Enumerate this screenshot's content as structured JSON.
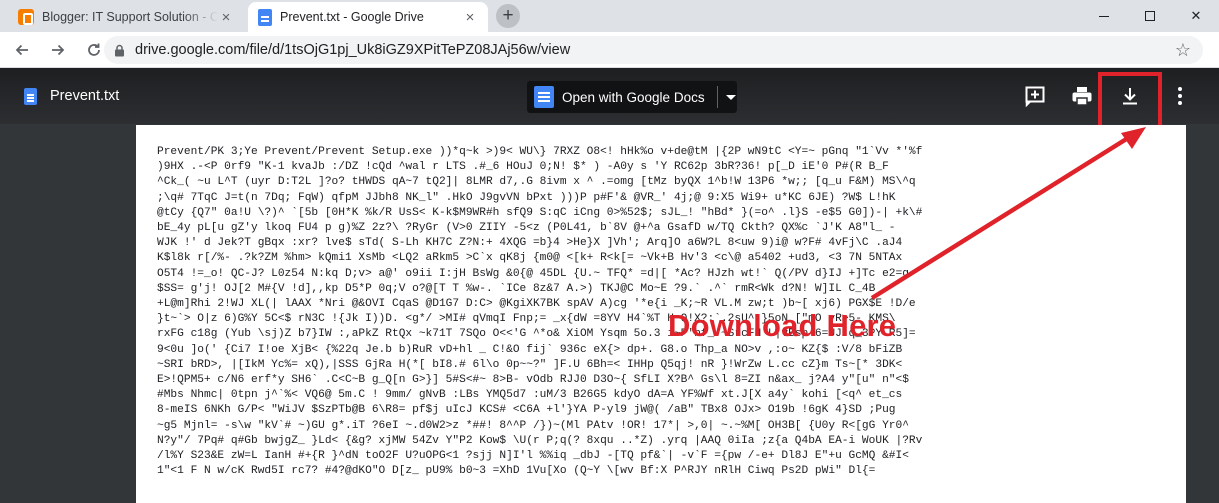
{
  "browser": {
    "tabs": [
      {
        "title": "Blogger: IT Support Solution - Cre",
        "active": false
      },
      {
        "title": "Prevent.txt - Google Drive",
        "active": true
      }
    ],
    "new_tab_label": "+",
    "close_glyph": "×",
    "window_close_glyph": "✕",
    "url": "drive.google.com/file/d/1tsOjG1pj_Uk8iGZ9XPitTePZ08JAj56w/view",
    "star_glyph": "☆"
  },
  "viewer": {
    "file_name": "Prevent.txt",
    "open_with_label": "Open with Google Docs",
    "icons": [
      "add-comment-icon",
      "print-icon",
      "download-icon",
      "more-vert-icon"
    ],
    "accent": "#e0232b"
  },
  "annotation": {
    "text": "Download Here"
  },
  "document": {
    "lines": [
      "Prevent/PK 3;Ye Prevent/Prevent Setup.exe ))*q~k >)9< WU\\} 7RXZ O8<! hHk%o v+de@tM |{2P wN9tC <Y=~ pGnq \"1`Vv *'%f",
      ")9HX .-<P 0rf9 \"K-1 kvaJb :/DZ !cQd ^wal r LTS .#_6 HOuJ 0;N! $* ) -A0y s 'Y RC62p 3bR?36! p[_D iE'0 P#(R B_F",
      "^Ck_( ~u L^T (uyr D:T2L ]?o? tHWDS qA~7 tQ2]| 8LMR d7,.G 8ivm x ^ .=omg [tMz byQX 1^b!W 13P6 *w;; [q_u F&M) MS\\^q",
      ";\\q# 7TqC J=t(n 7Dq; FqW) qfpM JJbh8 NK_l\" .HkO J9gvVN bPxt )))P p#F'& @VR_' 4j;@ 9:X5 Wi9+ u*KC 6JE) ?W$ L!hK",
      "@tCy {Q7\" 0a!U \\?)^ `[5b [0H*K %k/R UsS< K-k$M9WR#h sfQ9 S:qC iCng 0>%52$; sJL_! \"hBd* }(=o^ .l}S -e$5 G0])-| +k\\#",
      "bE_4y pL[u gZ'y lkoq FU4 p g)%Z 2z?\\ ?RyGr (V>0 ZIIY -5<z (P0L41, b`8V @+^a GsafD w/TQ Ckth? QX%c `J'K A8\"l_ -",
      "WJK !' d Jek?T gBqx :xr? lve$ sTd( S-Lh KH7C Z?N:+ 4XQG =b}4 >He}X ]Vh'; Arq]O a6W?L 8<uw 9)i@ w?F# 4vFj\\C .aJ4",
      "K$l8k r[/%- .?k?ZM %hm> kQmi1 XsMb <LQ2 aRkm5 >C`x qK8j {m0@ <[k+ R<k[= ~Vk+B Hv'3 <c\\@ a5402 +ud3, <3 7N 5NTAx",
      "O5T4 !=_o! QC-J? L0z54 N:kq D;v> a@' o9ii I:jH BsWg &0{@ 45DL {U.~ TFQ* =d|[ *Ac? HJzh wt!` Q(/PV d}IJ +]Tc e2=g",
      "$SS= g'j! OJ[2 M#{V !d],,kp D5*P 0q;V o?@[T T %w-. `ICe 8z&7 A.>) TKJ@C Mo~E ?9.` .^` rmR<Wk d?N! W]IL C_4B",
      "+L@m]Rhi 2!WJ XL(| lAAX *Nri @&OVI CqaS @D1G7 D:C> @KgiXK7BK spAV A)cg '*e{i _K;~R VL.M zw;t )b~[ xj6) PGX$E !D/e",
      "}t~`> O|z 6)G%Y 5C<$ rN3C !{Jk I))D. <g*/ >MI# qVmqI Fnp;= _x{dW =8YV H4`%T H Q!X?:`.2sU^ }5oN [\"mO vR>5- KMS\\",
      "rxFG c18g (Yub \\sj)Z b7}IW :,aPkZ RtQx ~k71T 7SQo O<<'G ^*o& XiOM Ysqm 5o.3 i~P'bf_ ~SrcFH L|vBsp 6=UJ q_3PY R5]=",
      "9<0u ]o(' {Ci7 I!oe XjB< {%22q Je.b b)RuR vD+hl _ C!&O fij` 936c eX{> dp+. G8.o Thp_a NO>v ,:o~ KZ{$ :V/8 bFiZB",
      "~SRI bRD>, |[IkM Yc%= xQ),|SSS GjRa H(*[ bI8.# 6l\\o 0p~~?\" ]F.U 6Bh=< IHHp Q5qj! nR }!WrZw L.cc cZ}m Ts~[* 3DK<",
      "E>!QPM5+ c/N6 erf*y SH6` .C<C~B g_Q[n G>}] 5#S<#~ 8>B- vOdb RJJ0 D3O~{ SfLI X?B^ Gs\\l 8=ZI n&ax_ j?A4 y\"[u\" n\"<$",
      "#Mbs Nhmc| 0tpn j^`%< VQ6@ 5m.C ! 9mm/ gNvB :LBs YMQ5d7 :uM/3 B26G5 kdyO dA=A YF%Wf xt.J[X a4y` kohi [<q^ et_cs",
      "8-meIS 6NKh G/P< \"WiJV $SzPTb@B 6\\R8= pf$j uIcJ KCS# <C6A +l'}YA P-yl9 jW@( /aB\" TBx8 OJx> O19b !6gK 4}SD ;Pug",
      "~g5 Mjnl= -s\\w \"kV`# ~)GU g*.iT ?6eI ~.d0W2>z *##! 8^^P /})~(Ml PAtv !OR! 17*| >,0| ~.~%M[ OH3B[ {U0y R<[gG Yr0^",
      "N?y\"/ 7Pq# q#Gb bwjgZ_ }Ld< {&g? xjMW 54Zv Y\"P2 Kow$ \\U(r P;q(? 8xqu ..*Z) .yrq |AAQ 0iIa ;z{a Q4bA EA-i WoUK |?Rv",
      "/l%Y S23&E zW=L IanH #+{R }^dN toO2F U?uOPG<1 ?sjj N]I'l %%iq _dbJ -[TQ pf&`| -v`F ={pw /-e+ Dl8J E\"+u GcMQ &#I<",
      "1\"<1 F N w/cK Rwd5I rc7? #4?@dKO\"O D[z_ pU9% b0~3 =XhD 1Vu[Xo (Q~Y \\[wv Bf:X P^RJY nRlH Ciwq Ps2D pWi\" Dl{="
    ]
  }
}
